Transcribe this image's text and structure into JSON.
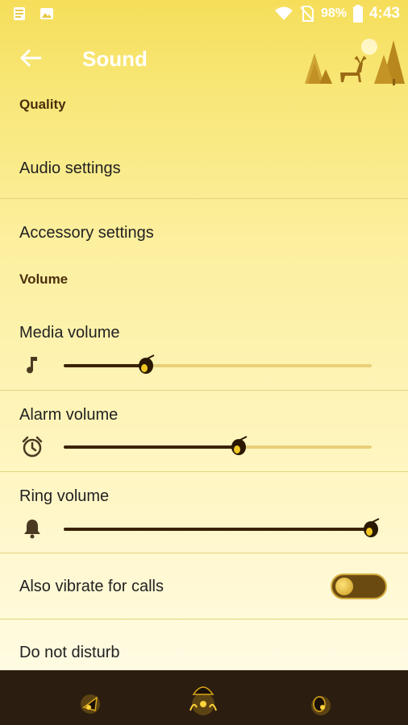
{
  "status_bar": {
    "battery_percent": "98%",
    "time": "4:43",
    "icons": [
      "file-notification-icon",
      "image-notification-icon",
      "wifi-icon",
      "no-sim-icon",
      "battery-icon"
    ]
  },
  "app_bar": {
    "title": "Sound",
    "back_icon": "arrow-left-icon"
  },
  "sections": {
    "quality_header": "Quality",
    "audio_settings": "Audio settings",
    "accessory_settings": "Accessory settings",
    "volume_header": "Volume"
  },
  "volumes": [
    {
      "label": "Media volume",
      "icon": "music-note-icon",
      "level": 0.27
    },
    {
      "label": "Alarm volume",
      "icon": "alarm-clock-icon",
      "level": 0.57
    },
    {
      "label": "Ring volume",
      "icon": "bell-icon",
      "level": 1.0
    }
  ],
  "vibrate": {
    "label": "Also vibrate for calls",
    "enabled": false
  },
  "do_not_disturb": "Do not disturb",
  "colors": {
    "accent": "#3a2208",
    "track": "#e8cf78",
    "bottom_nav": "#2b1d10",
    "header_gradient_top": "#f6de5a"
  },
  "bottom_nav": {
    "buttons": [
      "back-nav-icon",
      "home-nav-icon",
      "recents-nav-icon"
    ]
  }
}
